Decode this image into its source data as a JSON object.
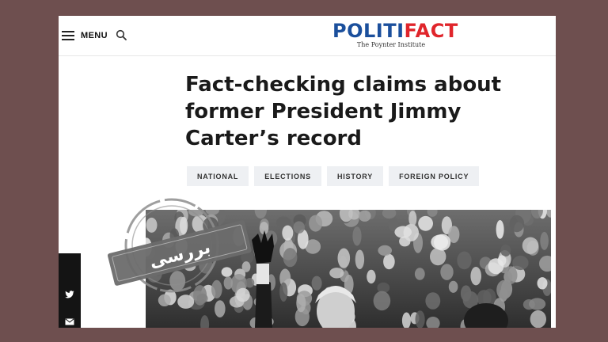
{
  "header": {
    "menu_label": "MENU",
    "logo": {
      "part1": "POLITI",
      "part2": "FACT",
      "sub": "The Poynter Institute",
      "color_part1": "#1b4f9c",
      "color_part2": "#e0252b"
    },
    "icons": [
      "hamburger-icon",
      "search-icon"
    ]
  },
  "article": {
    "headline": "Fact-checking claims about former President Jimmy Carter’s record",
    "tags": [
      "NATIONAL",
      "ELECTIONS",
      "HISTORY",
      "FOREIGN POLICY"
    ]
  },
  "share": {
    "icons": [
      "twitter-icon",
      "email-icon"
    ]
  },
  "stamp": {
    "text": "بررسی",
    "color": "#6b6b6b"
  },
  "colors": {
    "background": "#6e4f4f",
    "tag_bg": "#eef0f3"
  }
}
